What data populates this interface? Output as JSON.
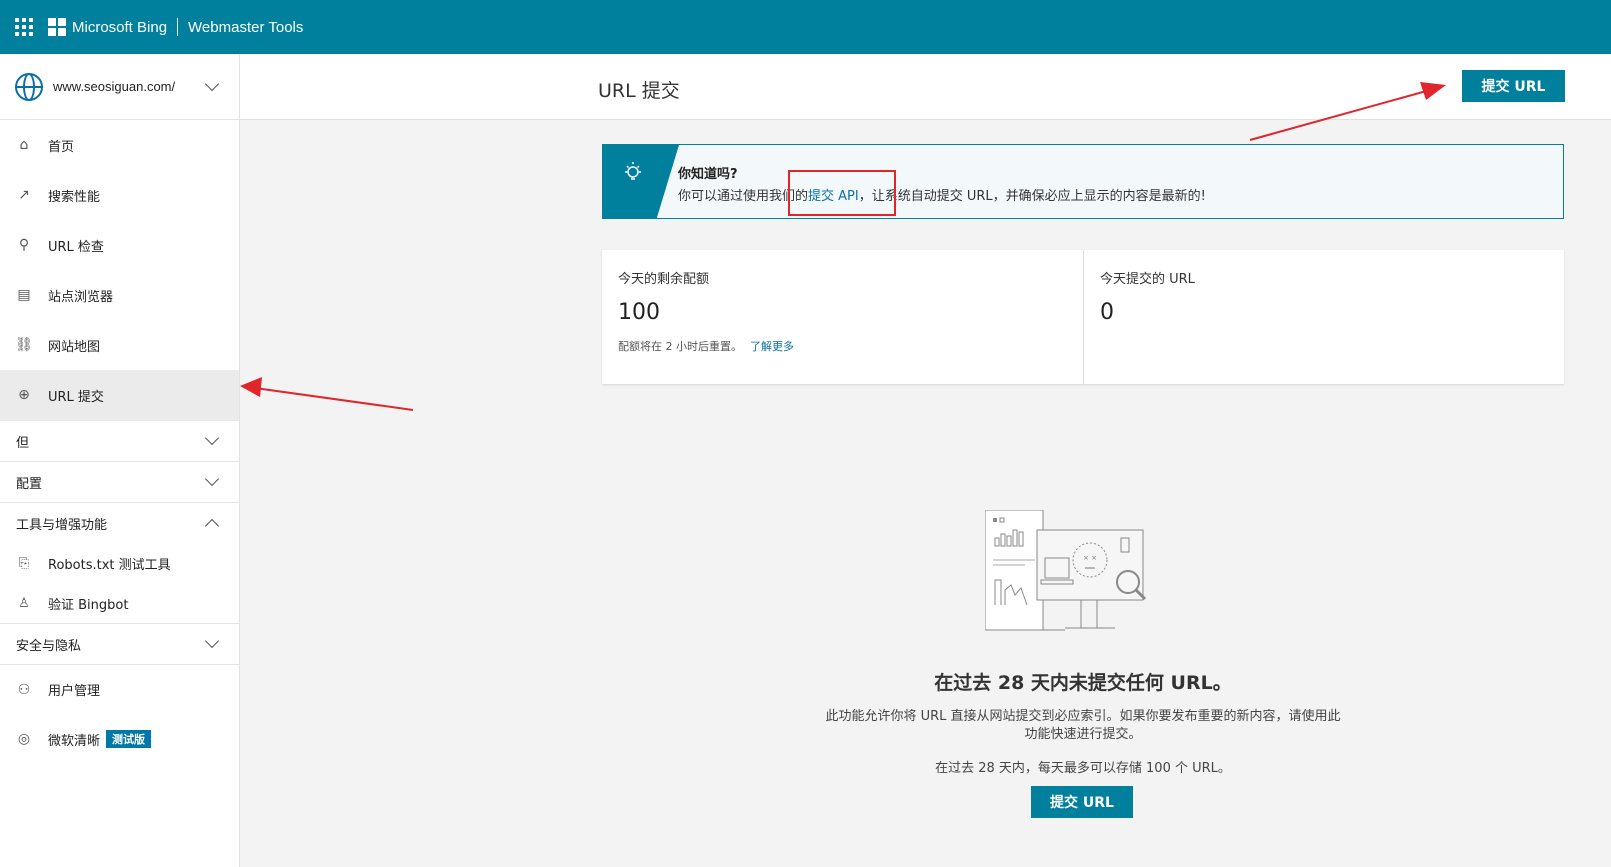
{
  "topbar": {
    "brand": "Microsoft Bing",
    "product": "Webmaster Tools"
  },
  "sidebar": {
    "site_url": "www.seosiguan.com/",
    "items": [
      {
        "label": "首页",
        "icon": "home-icon"
      },
      {
        "label": "搜索性能",
        "icon": "trend-icon"
      },
      {
        "label": "URL 检查",
        "icon": "search-icon"
      },
      {
        "label": "站点浏览器",
        "icon": "document-icon"
      },
      {
        "label": "网站地图",
        "icon": "sitemap-icon"
      },
      {
        "label": "URL 提交",
        "icon": "globe-icon"
      }
    ],
    "sections": {
      "s1": "但",
      "s2": "配置",
      "s3": "工具与增强功能",
      "s4": "安全与隐私"
    },
    "tools": [
      {
        "label": "Robots.txt 测试工具",
        "icon": "code-file-icon"
      },
      {
        "label": "验证 Bingbot",
        "icon": "bot-icon"
      }
    ],
    "bottom": [
      {
        "label": "用户管理",
        "icon": "user-icon"
      },
      {
        "label": "微软清晰",
        "icon": "clarity-icon",
        "badge": "测试版"
      }
    ]
  },
  "header": {
    "title": "URL 提交",
    "submit_button": "提交 URL"
  },
  "tip": {
    "title": "你知道吗?",
    "before": "你可以通过使用我们的",
    "link": "提交 API",
    "after": "，让系统自动提交 URL，并确保必应上显示的内容是最新的!"
  },
  "stats": {
    "quota_label": "今天的剩余配额",
    "quota_value": "100",
    "quota_note": "配额将在 2 小时后重置。",
    "quota_link": "了解更多",
    "submitted_label": "今天提交的 URL",
    "submitted_value": "0"
  },
  "empty": {
    "title": "在过去 28 天内未提交任何 URL。",
    "description": "此功能允许你将 URL 直接从网站提交到必应索引。如果你要发布重要的新内容，请使用此功能快速进行提交。",
    "note": "在过去 28 天内，每天最多可以存储 100 个 URL。",
    "button": "提交 URL"
  },
  "colors": {
    "brand": "#00809d",
    "link": "#0a6fa8",
    "annotation": "#e0252b"
  }
}
